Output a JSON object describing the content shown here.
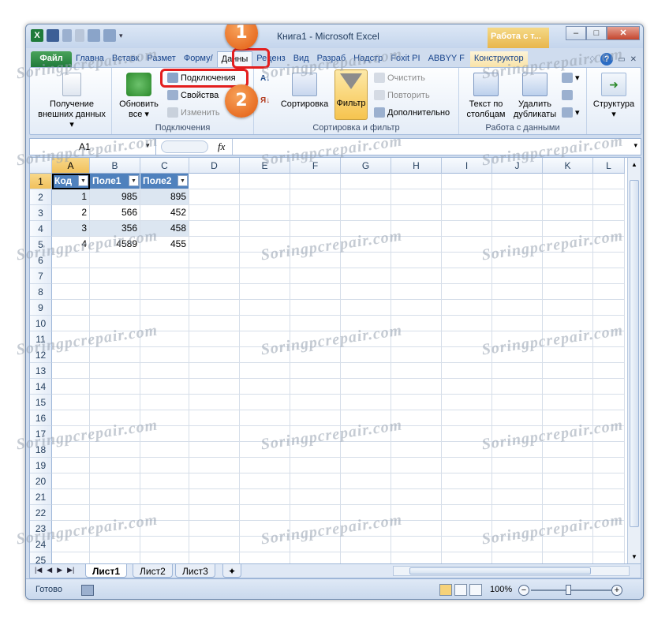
{
  "window": {
    "title": "Книга1 - Microsoft Excel",
    "context_title": "Работа с т...",
    "logo_letter": "X"
  },
  "tabs": [
    {
      "label": "Файл",
      "kind": "file"
    },
    {
      "label": "Главна",
      "kind": "normal"
    },
    {
      "label": "Вставк",
      "kind": "normal"
    },
    {
      "label": "Размет",
      "kind": "normal"
    },
    {
      "label": "Форму/",
      "kind": "normal"
    },
    {
      "label": "Данны",
      "kind": "active"
    },
    {
      "label": "Реценз",
      "kind": "normal"
    },
    {
      "label": "Вид",
      "kind": "normal"
    },
    {
      "label": "Разраб",
      "kind": "normal"
    },
    {
      "label": "Надстр",
      "kind": "normal"
    },
    {
      "label": "Foxit PI",
      "kind": "normal"
    },
    {
      "label": "ABBYY F",
      "kind": "normal"
    },
    {
      "label": "Конструктор",
      "kind": "ctx"
    }
  ],
  "ribbon": {
    "external_data": {
      "line1": "Получение",
      "line2": "внешних данных"
    },
    "refresh": {
      "line1": "Обновить",
      "line2": "все"
    },
    "connections_btn": "Подключения",
    "properties_btn": "Свойства",
    "edit_links_btn": "Изменить",
    "connections_group": "Подключения",
    "sort_btn": "Сортировка",
    "filter_btn": "Фильтр",
    "clear_btn": "Очистить",
    "reapply_btn": "Повторить",
    "advanced_btn": "Дополнительно",
    "sort_filter_group": "Сортировка и фильтр",
    "text_to_columns": {
      "line1": "Текст по",
      "line2": "столбцам"
    },
    "remove_duplicates": {
      "line1": "Удалить",
      "line2": "дубликаты"
    },
    "data_tools_group": "Работа с данными",
    "outline_btn": "Структура"
  },
  "callouts": {
    "one": "1",
    "two": "2"
  },
  "formula_bar": {
    "name_box": "A1",
    "fx": "fx",
    "formula": ""
  },
  "columns": [
    "A",
    "B",
    "C",
    "D",
    "E",
    "F",
    "G",
    "H",
    "I",
    "J",
    "K",
    "L"
  ],
  "rows": [
    "1",
    "2",
    "3",
    "4",
    "5",
    "6",
    "7",
    "8",
    "9",
    "10",
    "11",
    "12",
    "13",
    "14",
    "15",
    "16",
    "17",
    "18",
    "19",
    "20",
    "21",
    "22",
    "23",
    "24",
    "25"
  ],
  "table": {
    "headers": [
      "Код",
      "Поле1",
      "Поле2"
    ],
    "rows": [
      [
        "1",
        "985",
        "895"
      ],
      [
        "2",
        "566",
        "452"
      ],
      [
        "3",
        "356",
        "458"
      ],
      [
        "4",
        "4589",
        "455"
      ]
    ]
  },
  "sheets": [
    "Лист1",
    "Лист2",
    "Лист3"
  ],
  "status": {
    "ready": "Готово",
    "zoom": "100%"
  },
  "watermark": "Soringpcrepair.com"
}
